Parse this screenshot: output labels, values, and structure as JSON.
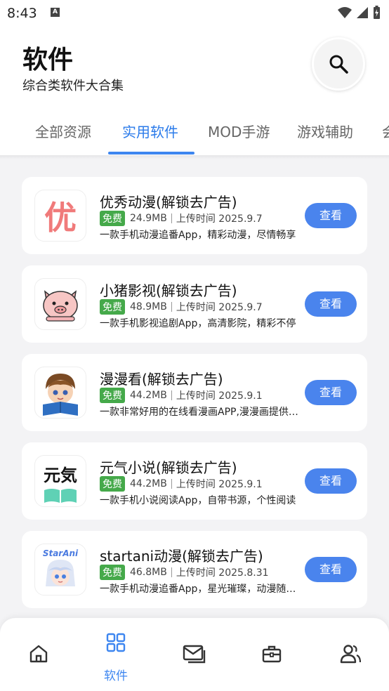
{
  "status_bar": {
    "time": "8:43",
    "notification_letter": "A"
  },
  "header": {
    "title": "软件",
    "subtitle": "综合类软件大合集"
  },
  "tabs": [
    {
      "label": "全部资源",
      "active": false
    },
    {
      "label": "实用软件",
      "active": true
    },
    {
      "label": "MOD手游",
      "active": false
    },
    {
      "label": "游戏辅助",
      "active": false
    },
    {
      "label": "会",
      "active": false
    }
  ],
  "apps": [
    {
      "name": "优秀动漫(解锁去广告)",
      "badge": "免费",
      "size": "24.9MB",
      "upload": "上传时间 2025.9.7",
      "desc": "一款手机动漫追番App，精彩动漫，尽情畅享",
      "button": "查看",
      "icon": "you-logo-icon",
      "icon_text": "优"
    },
    {
      "name": "小猪影视(解锁去广告)",
      "badge": "免费",
      "size": "48.9MB",
      "upload": "上传时间 2025.9.7",
      "desc": "一款手机影视追剧App，高清影院，精彩不停",
      "button": "查看",
      "icon": "pig-face-icon"
    },
    {
      "name": "漫漫看(解锁去广告)",
      "badge": "免费",
      "size": "44.2MB",
      "upload": "上传时间 2025.9.1",
      "desc": "一款非常好用的在线看漫画APP,漫漫画提供海量",
      "button": "查看",
      "icon": "boy-reading-icon"
    },
    {
      "name": "元气小说(解锁去广告)",
      "badge": "免费",
      "size": "44.2MB",
      "upload": "上传时间 2025.9.1",
      "desc": "一款手机小说阅读App，自带书源，个性阅读",
      "button": "查看",
      "icon": "yuanqi-book-icon",
      "icon_text": "元気"
    },
    {
      "name": "startani动漫(解锁去广告)",
      "badge": "免费",
      "size": "46.8MB",
      "upload": "上传时间 2025.8.31",
      "desc": "一款手机动漫追番App，星光璀璨，动漫随心看",
      "button": "查看",
      "icon": "startani-logo-icon",
      "icon_text": "StarAni"
    }
  ],
  "bottom_nav": [
    {
      "icon": "home-icon",
      "label": "",
      "active": false
    },
    {
      "icon": "grid-icon",
      "label": "软件",
      "active": true
    },
    {
      "icon": "mail-icon",
      "label": "",
      "active": false
    },
    {
      "icon": "toolbox-icon",
      "label": "",
      "active": false
    },
    {
      "icon": "users-icon",
      "label": "",
      "active": false
    }
  ],
  "colors": {
    "accent": "#3d86f0",
    "button": "#4a84ed",
    "badge": "#45a94a"
  }
}
